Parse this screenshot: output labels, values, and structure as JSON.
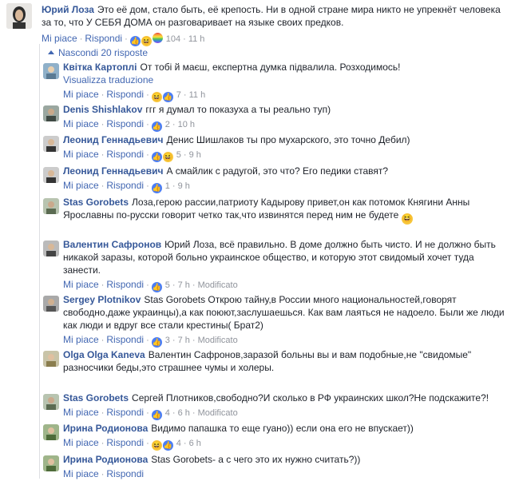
{
  "top_comment": {
    "author": "Юрий Лоза",
    "text": "Это её дом, стало быть, её крепость. Ни в одной стране мира никто не упрекнёт человека за то, что У СЕБЯ ДОМА он разговаривает на языке своих предков.",
    "like_label": "Mi piace",
    "reply_label": "Rispondi",
    "reaction_count": "104",
    "time": "11 h"
  },
  "replies_toggle": "Nascondi 20 risposte",
  "replies": [
    {
      "author": "Квітка Картоплі",
      "text": "От тобі й маєш, експертна думка підвалила. Розходимось!",
      "translate": "Visualizza traduzione",
      "count": "7",
      "time": "11 h",
      "edited": ""
    },
    {
      "author": "Denis Shishlakov",
      "text": "ггг я думал то показуха а ты реально туп)",
      "count": "2",
      "time": "10 h",
      "edited": ""
    },
    {
      "author": "Леонид Геннадьевич",
      "text": "Денис Шишлаков ты про мухарского, это точно Дебил)",
      "count": "5",
      "time": "9 h",
      "edited": ""
    },
    {
      "author": "Леонид Геннадьевич",
      "text": "А смайлик с радугой, это что? Его педики ставят?",
      "count": "1",
      "time": "9 h",
      "edited": ""
    },
    {
      "author": "Stas Gorobets",
      "text": "Лоза,герою рассии,патриоту Кадырову привет,он как потомок Княгини Анны Ярославны по-русски говорит четко так,что извинятся перед ним не будете",
      "count": "",
      "time": "",
      "edited": ""
    },
    {
      "author": "Валентин Сафронов",
      "text": "Юрий Лоза, всё правильно. В доме должно быть чисто. И не должно быть никакой заразы, которой больно украинское общество, и которую этот свидомый хочет туда занести.",
      "count": "5",
      "time": "7 h",
      "edited": "Modificato"
    },
    {
      "author": "Sergey Plotnikov",
      "text": "Stas Gorobets Открою тайну,в России много национальностей,говорят свободно,даже украинцы),а как поюют,заслушаешься. Как вам лаяться не надоело. Были же люди как люди и вдруг все стали крестины( Брат2)",
      "count": "3",
      "time": "7 h",
      "edited": "Modificato"
    },
    {
      "author": "Olga Olga Kaneva",
      "text": "Валентин Сафронов,заразой больны вы и вам подобные,не \"свидомые\" разносчики беды,это страшнее чумы и холеры.",
      "count": "",
      "time": "",
      "edited": ""
    },
    {
      "author": "Stas Gorobets",
      "text": "Сергей Плотников,свободно?И сколько в РФ украинских школ?Не подскажите?!",
      "count": "4",
      "time": "6 h",
      "edited": "Modificato"
    },
    {
      "author": "Ирина Родионова",
      "text": "Видимо папашка то еще гуано)) если она его не впускает))",
      "count": "4",
      "time": "6 h",
      "edited": ""
    },
    {
      "author": "Ирина Родионова",
      "text": "Stas Gorobets- а с чего это их нужно считать?))",
      "count": "",
      "time": "",
      "edited": ""
    }
  ],
  "labels": {
    "like": "Mi piace",
    "reply": "Rispondi"
  },
  "colors": {
    "link": "#4267b2",
    "author": "#365899",
    "meta": "#90949c"
  }
}
